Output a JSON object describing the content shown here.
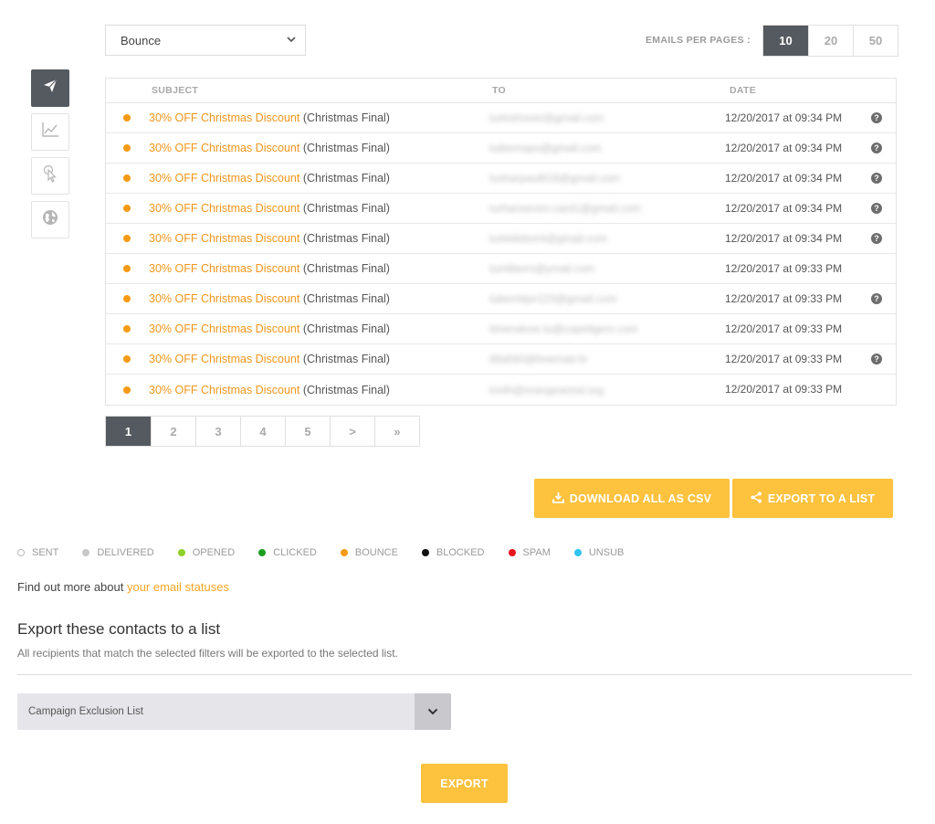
{
  "filter": {
    "value": "Bounce"
  },
  "per_page": {
    "label": "EMAILS PER PAGES :",
    "options": [
      "10",
      "20",
      "50"
    ],
    "selected": "10"
  },
  "sidenav": {
    "items": [
      {
        "name": "send",
        "icon": "paper-plane-icon",
        "active": true
      },
      {
        "name": "stats",
        "icon": "chart-icon",
        "active": false
      },
      {
        "name": "clicks",
        "icon": "click-pointer-icon",
        "active": false
      },
      {
        "name": "geo",
        "icon": "globe-icon",
        "active": false
      }
    ]
  },
  "table": {
    "headers": {
      "subject": "SUBJECT",
      "to": "TO",
      "date": "DATE"
    },
    "status_color": "#f59a14",
    "rows": [
      {
        "subject": "30% OFF Christmas Discount",
        "campaign": "(Christmas Final)",
        "to": "turkishover@gmail.com",
        "date": "12/20/2017 at 09:34 PM",
        "help": true
      },
      {
        "subject": "30% OFF Christmas Discount",
        "campaign": "(Christmas Final)",
        "to": "tuibemapo@gmail.com",
        "date": "12/20/2017 at 09:34 PM",
        "help": true
      },
      {
        "subject": "30% OFF Christmas Discount",
        "campaign": "(Christmas Final)",
        "to": "tusharpaul616@gmail.com",
        "date": "12/20/2017 at 09:34 PM",
        "help": true
      },
      {
        "subject": "30% OFF Christmas Discount",
        "campaign": "(Christmas Final)",
        "to": "turhanseven.card1@gmail.com",
        "date": "12/20/2017 at 09:34 PM",
        "help": true
      },
      {
        "subject": "30% OFF Christmas Discount",
        "campaign": "(Christmas Final)",
        "to": "turkbilatomt@gmail.com",
        "date": "12/20/2017 at 09:34 PM",
        "help": true
      },
      {
        "subject": "30% OFF Christmas Discount",
        "campaign": "(Christmas Final)",
        "to": "tumliborn@ymail.com",
        "date": "12/20/2017 at 09:33 PM",
        "help": false
      },
      {
        "subject": "30% OFF Christmas Discount",
        "campaign": "(Christmas Final)",
        "to": "tubembjsr123@gmail.com",
        "date": "12/20/2017 at 09:33 PM",
        "help": true
      },
      {
        "subject": "30% OFF Christmas Discount",
        "campaign": "(Christmas Final)",
        "to": "ttmendose.tu@capetigers.com",
        "date": "12/20/2017 at 09:33 PM",
        "help": false
      },
      {
        "subject": "30% OFF Christmas Discount",
        "campaign": "(Christmas Final)",
        "to": "ttlla560@freemail.hr",
        "date": "12/20/2017 at 09:33 PM",
        "help": true
      },
      {
        "subject": "30% OFF Christmas Discount",
        "campaign": "(Christmas Final)",
        "to": "tnnlh@orangewood.org",
        "date": "12/20/2017 at 09:33 PM",
        "help": false
      }
    ]
  },
  "pagination": {
    "pages": [
      "1",
      "2",
      "3",
      "4",
      "5",
      ">",
      "»"
    ],
    "current": "1"
  },
  "actions": {
    "download_csv": "DOWNLOAD ALL AS CSV",
    "export_to_list": "EXPORT TO A LIST",
    "color": "#fdc23e"
  },
  "legend": [
    {
      "label": "SENT",
      "color": "#ffffff",
      "hollow": true
    },
    {
      "label": "DELIVERED",
      "color": "#c8c8c8"
    },
    {
      "label": "OPENED",
      "color": "#8ed12a"
    },
    {
      "label": "CLICKED",
      "color": "#1e9e1e"
    },
    {
      "label": "BOUNCE",
      "color": "#f59a14"
    },
    {
      "label": "BLOCKED",
      "color": "#111111"
    },
    {
      "label": "SPAM",
      "color": "#e8141e"
    },
    {
      "label": "UNSUB",
      "color": "#2ec5f0"
    }
  ],
  "findout": {
    "text": "Find out more about ",
    "link": "your email statuses"
  },
  "export_section": {
    "title": "Export these contacts to a list",
    "description": "All recipients that match the selected filters will be exported to the selected list.",
    "list_value": "Campaign Exclusion List",
    "button": "EXPORT"
  }
}
